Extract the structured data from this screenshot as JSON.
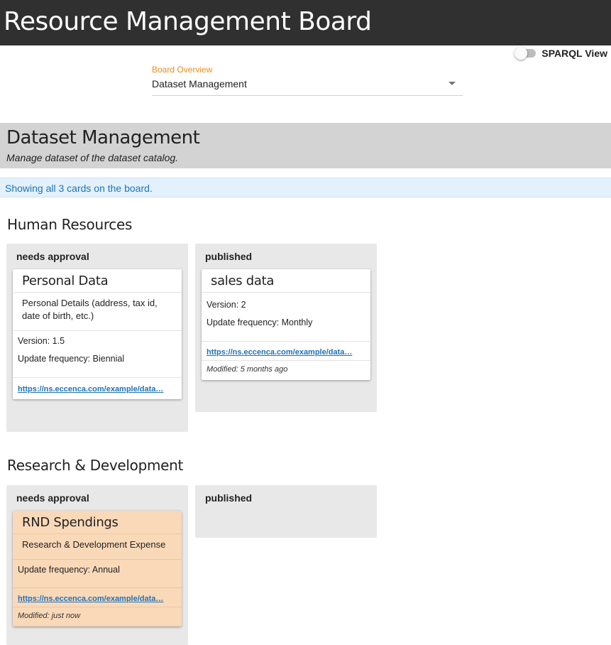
{
  "app": {
    "title": "Resource Management Board"
  },
  "sparql_toggle": {
    "label": "SPARQL View",
    "on": false
  },
  "board_select": {
    "label": "Board Overview",
    "value": "Dataset Management"
  },
  "board": {
    "title": "Dataset Management",
    "description": "Manage dataset of the dataset catalog."
  },
  "info": {
    "text": "Showing all 3 cards on the board."
  },
  "colors": {
    "appbar": "#303030",
    "accent": "#ef8c1b",
    "link": "#1e72b9",
    "highlight_card": "#fad9b9"
  },
  "sections": [
    {
      "title": "Human Resources",
      "columns": [
        {
          "title": "needs approval",
          "cards": [
            {
              "title": "Personal Data",
              "description": "Personal Details (address, tax id, date of birth, etc.)",
              "version": "Version: 1.5",
              "frequency": "Update frequency: Biennial",
              "link": "https://ns.eccenca.com/example/data…"
            }
          ]
        },
        {
          "title": "published",
          "cards": [
            {
              "title": "sales data",
              "version": "Version: 2",
              "frequency": "Update frequency: Monthly",
              "link": "https://ns.eccenca.com/example/data…",
              "modified": "Modified: 5 months ago"
            }
          ]
        }
      ]
    },
    {
      "title": "Research & Development",
      "columns": [
        {
          "title": "needs approval",
          "cards": [
            {
              "title": "RND Spendings",
              "description": "Research & Development Expense",
              "frequency": "Update frequency: Annual",
              "link": "https://ns.eccenca.com/example/data…",
              "modified": "Modified: just now"
            }
          ]
        },
        {
          "title": "published",
          "cards": []
        }
      ]
    }
  ]
}
